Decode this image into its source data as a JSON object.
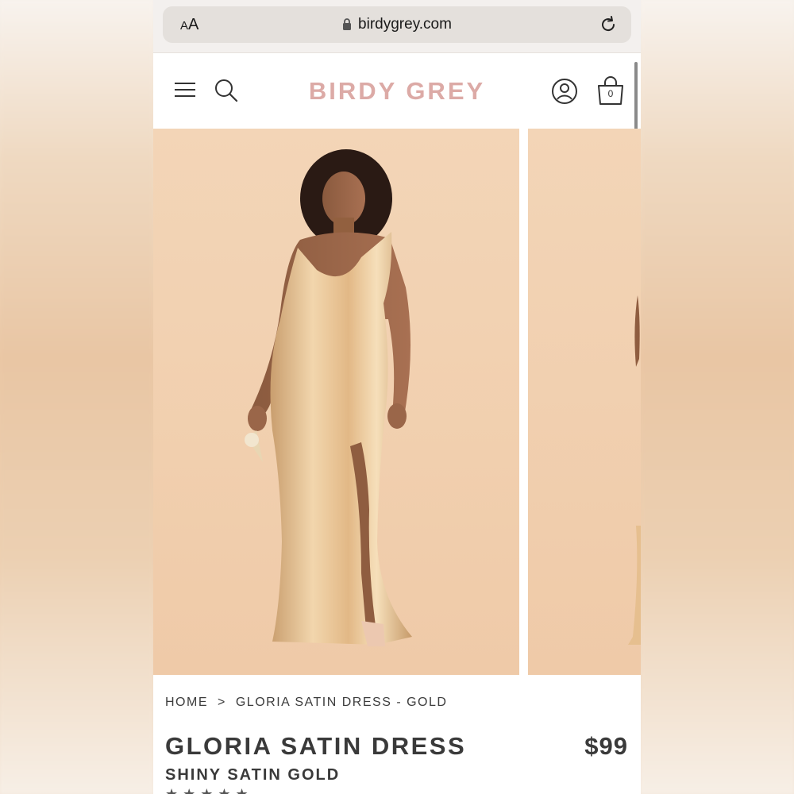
{
  "browser": {
    "text_size_label_small": "A",
    "text_size_label_large": "A",
    "url": "birdygrey.com",
    "icons": {
      "lock": "lock-icon",
      "reload": "reload-icon"
    }
  },
  "site": {
    "brand": "BIRDY GREY",
    "bag_count": "0",
    "icons": {
      "menu": "hamburger-icon",
      "search": "search-icon",
      "account": "account-icon",
      "bag": "shopping-bag-icon"
    },
    "colors": {
      "brand": "#dcaaa6",
      "photo_background": "#f2d2b2",
      "dress": "#e2b886"
    }
  },
  "breadcrumb": {
    "home": "HOME",
    "separator": ">",
    "current": "GLORIA SATIN DRESS - GOLD"
  },
  "product": {
    "title": "GLORIA SATIN DRESS",
    "price": "$99",
    "subtitle": "SHINY SATIN GOLD",
    "rating_stars": "★★★★★"
  }
}
